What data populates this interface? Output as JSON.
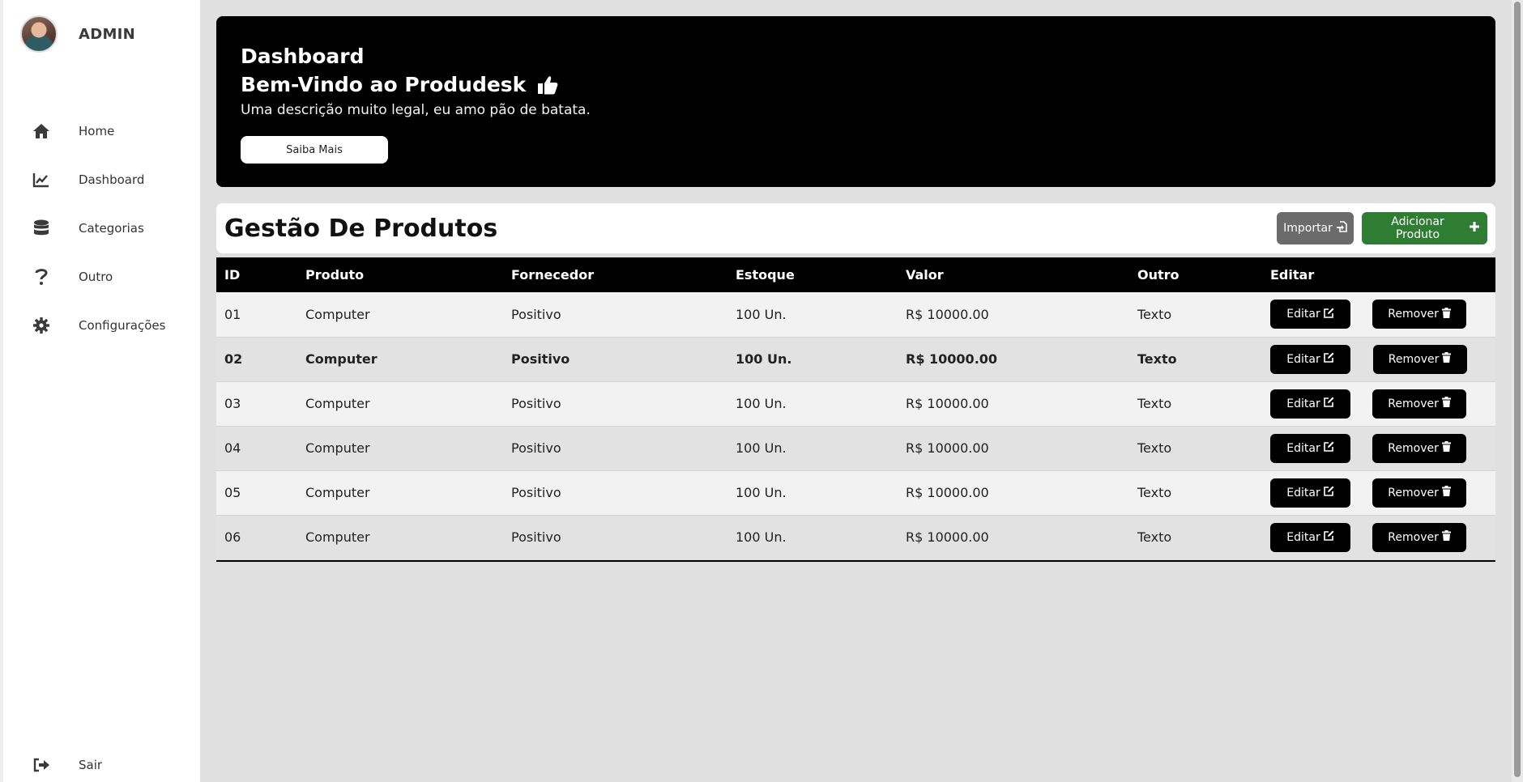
{
  "sidebar": {
    "profile_name": "ADMIN",
    "items": [
      {
        "label": "Home",
        "icon": "home-icon"
      },
      {
        "label": "Dashboard",
        "icon": "chart-line-icon"
      },
      {
        "label": "Categorias",
        "icon": "database-icon"
      },
      {
        "label": "Outro",
        "icon": "question-icon"
      },
      {
        "label": "Configurações",
        "icon": "gear-icon"
      }
    ],
    "logout_label": "Sair"
  },
  "hero": {
    "title": "Dashboard",
    "subtitle": "Bem-Vindo ao Produdesk",
    "description": "Uma descrição muito legal, eu amo pão de batata.",
    "button_label": "Saiba Mais"
  },
  "products": {
    "title": "Gestão De Produtos",
    "import_label": "Importar",
    "add_label": "Adicionar Produto",
    "columns": [
      "ID",
      "Produto",
      "Fornecedor",
      "Estoque",
      "Valor",
      "Outro",
      "Editar"
    ],
    "rows": [
      {
        "id": "01",
        "produto": "Computer",
        "fornecedor": "Positivo",
        "estoque": "100 Un.",
        "valor": "R$ 10000.00",
        "outro": "Texto"
      },
      {
        "id": "02",
        "produto": "Computer",
        "fornecedor": "Positivo",
        "estoque": "100 Un.",
        "valor": "R$ 10000.00",
        "outro": "Texto"
      },
      {
        "id": "03",
        "produto": "Computer",
        "fornecedor": "Positivo",
        "estoque": "100 Un.",
        "valor": "R$ 10000.00",
        "outro": "Texto"
      },
      {
        "id": "04",
        "produto": "Computer",
        "fornecedor": "Positivo",
        "estoque": "100 Un.",
        "valor": "R$ 10000.00",
        "outro": "Texto"
      },
      {
        "id": "05",
        "produto": "Computer",
        "fornecedor": "Positivo",
        "estoque": "100 Un.",
        "valor": "R$ 10000.00",
        "outro": "Texto"
      },
      {
        "id": "06",
        "produto": "Computer",
        "fornecedor": "Positivo",
        "estoque": "100 Un.",
        "valor": "R$ 10000.00",
        "outro": "Texto"
      }
    ],
    "edit_label": "Editar",
    "remove_label": "Remover"
  },
  "colors": {
    "accent_green": "#2e7d32",
    "import_gray": "#6b6b6b",
    "hero_bg": "#000000",
    "page_bg": "#e0e0e0"
  }
}
